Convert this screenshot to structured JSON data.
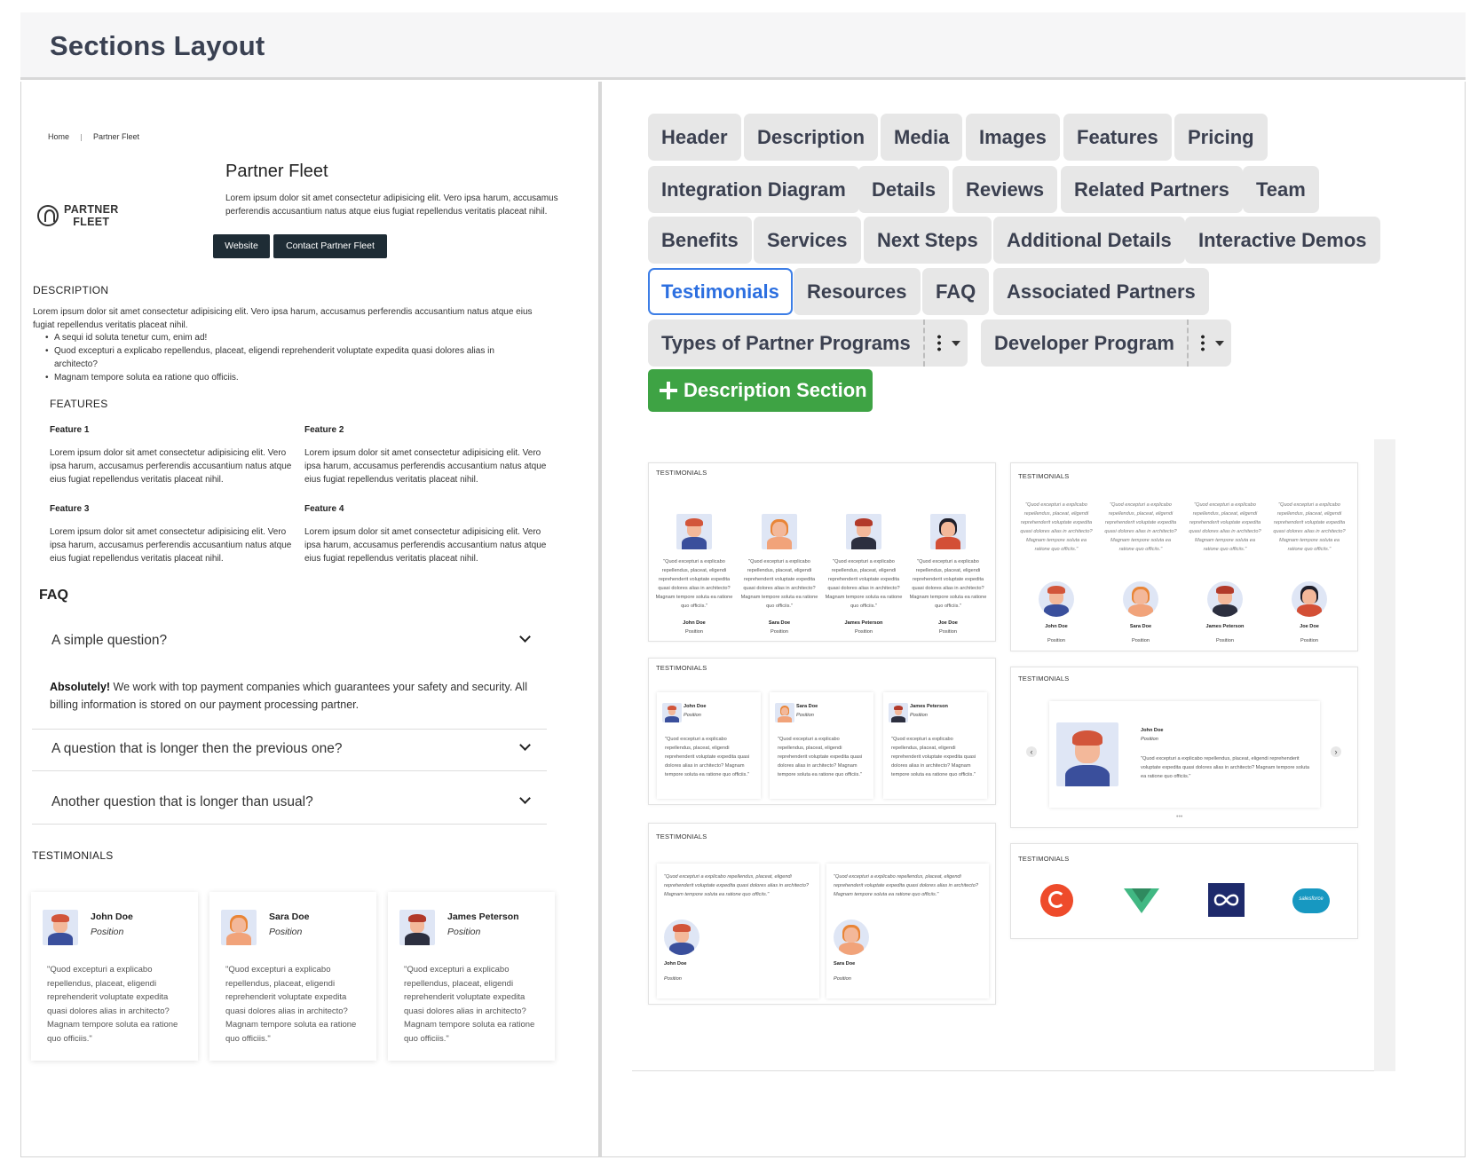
{
  "page": {
    "title": "Sections Layout"
  },
  "preview": {
    "breadcrumb": {
      "home": "Home",
      "current": "Partner Fleet"
    },
    "logo": {
      "line1": "PARTNER",
      "line2": "FLEET"
    },
    "partner_title": "Partner Fleet",
    "partner_desc": "Lorem ipsum dolor sit amet consectetur adipisicing elit. Vero ipsa harum, accusamus perferendis accusantium natus atque eius fugiat repellendus veritatis placeat nihil.",
    "buttons": {
      "website": "Website",
      "contact": "Contact Partner Fleet"
    },
    "description": {
      "heading": "DESCRIPTION",
      "text": "Lorem ipsum dolor sit amet consectetur adipisicing elit. Vero ipsa harum, accusamus perferendis accusantium natus atque eius fugiat repellendus veritatis placeat nihil.",
      "bullets": [
        "A sequi id soluta tenetur cum, enim ad!",
        "Quod excepturi a explicabo repellendus, placeat, eligendi reprehenderit voluptate expedita quasi dolores alias in architecto?",
        "Magnam tempore soluta ea ratione quo officiis."
      ]
    },
    "features": {
      "heading": "FEATURES",
      "items": [
        {
          "title": "Feature 1",
          "text": "Lorem ipsum dolor sit amet consectetur adipisicing elit. Vero ipsa harum, accusamus perferendis accusantium natus atque eius fugiat repellendus veritatis placeat nihil."
        },
        {
          "title": "Feature 2",
          "text": "Lorem ipsum dolor sit amet consectetur adipisicing elit. Vero ipsa harum, accusamus perferendis accusantium natus atque eius fugiat repellendus veritatis placeat nihil."
        },
        {
          "title": "Feature 3",
          "text": "Lorem ipsum dolor sit amet consectetur adipisicing elit. Vero ipsa harum, accusamus perferendis accusantium natus atque eius fugiat repellendus veritatis placeat nihil."
        },
        {
          "title": "Feature 4",
          "text": "Lorem ipsum dolor sit amet consectetur adipisicing elit. Vero ipsa harum, accusamus perferendis accusantium natus atque eius fugiat repellendus veritatis placeat nihil."
        }
      ]
    },
    "faq": {
      "heading": "FAQ",
      "q1": "A simple question?",
      "answer_bold": "Absolutely!",
      "answer_rest": " We work with top payment companies which guarantees your safety and security. All billing information is stored on our payment processing partner.",
      "q2": "A question that is longer then the previous one?",
      "q3": "Another question that is longer than usual?"
    },
    "testimonials": {
      "heading": "TESTIMONIALS",
      "cards": [
        {
          "name": "John Doe",
          "position": "Position",
          "quote": "\"Quod excepturi a explicabo repellendus, placeat, eligendi reprehenderit voluptate expedita quasi dolores alias in architecto? Magnam tempore soluta ea ratione quo officiis.\""
        },
        {
          "name": "Sara Doe",
          "position": "Position",
          "quote": "\"Quod excepturi a explicabo repellendus, placeat, eligendi reprehenderit voluptate expedita quasi dolores alias in architecto? Magnam tempore soluta ea ratione quo officiis.\""
        },
        {
          "name": "James Peterson",
          "position": "Position",
          "quote": "\"Quod excepturi a explicabo repellendus, placeat, eligendi reprehenderit voluptate expedita quasi dolores alias in architecto? Magnam tempore soluta ea ratione quo officiis.\""
        }
      ]
    }
  },
  "sections": {
    "row1": [
      "Header",
      "Description",
      "Media",
      "Images",
      "Features",
      "Pricing"
    ],
    "row2": [
      "Integration Diagram",
      "Details",
      "Reviews",
      "Related Partners",
      "Team"
    ],
    "row3": [
      "Benefits",
      "Services",
      "Next Steps",
      "Additional Details",
      "Interactive Demos"
    ],
    "row4": [
      "Testimonials",
      "Resources",
      "FAQ",
      "Associated Partners"
    ],
    "custom": [
      "Types of Partner Programs",
      "Developer Program"
    ],
    "active": "Testimonials",
    "add_button": "Description Section"
  },
  "layouts": {
    "heading": "TESTIMONIALS",
    "people": [
      {
        "name": "John Doe",
        "position": "Position"
      },
      {
        "name": "Sara Doe",
        "position": "Position"
      },
      {
        "name": "James Peterson",
        "position": "Position"
      },
      {
        "name": "Joe Doe",
        "position": "Position"
      }
    ],
    "quote_short": "\"Quod excepturi a explicabo repellendus, placeat, eligendi reprehenderit voluptate expedita quasi dolores alias in architecto? Magnam tempore soluta ea ratione quo officiis.\"",
    "quote_carousel": "\"Quod excepturi a explicabo repellendus, placeat, eligendi reprehenderit voluptate expedita quasi dolores alias in architecto? Magnam tempore soluta ea ratione quo officiis.\"",
    "brands": [
      "g2-logo-icon",
      "vuejs-logo-icon",
      "infinity-logo-icon",
      "salesforce-logo-icon"
    ],
    "salesforce_text": "salesforce"
  },
  "colors": {
    "accent_blue": "#2c6fe0",
    "add_green": "#3ea344",
    "dark_button": "#1e2c35"
  }
}
